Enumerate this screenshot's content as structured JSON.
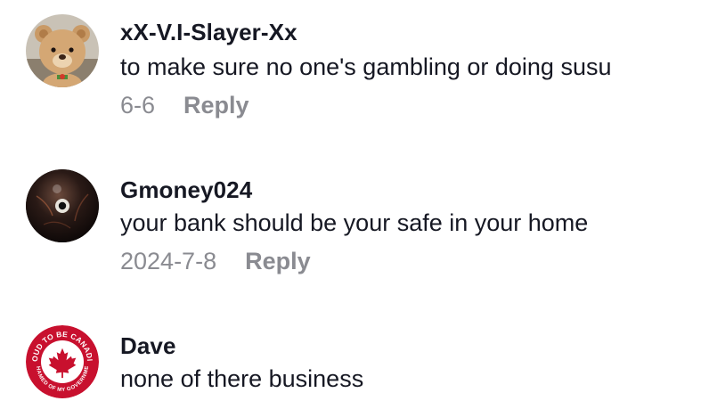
{
  "comments": [
    {
      "username": "xX-V.I-Slayer-Xx",
      "text": "to make sure no one's gambling or doing susu",
      "date": "6-6",
      "reply_label": "Reply",
      "avatar_icon": "teddy-bear-avatar"
    },
    {
      "username": "Gmoney024",
      "text": "your bank should be your safe in your home",
      "date": "2024-7-8",
      "reply_label": "Reply",
      "avatar_icon": "eight-ball-avatar"
    },
    {
      "username": "Dave",
      "text": "none of there business",
      "avatar_icon": "canadian-badge-avatar",
      "badge_top_text": "PROUD TO BE CANADIAN",
      "badge_bottom_text": "ASHAMED OF MY GOVERNMENT"
    }
  ],
  "colors": {
    "text": "#161823",
    "secondary": "#8a8b91",
    "badge_red": "#c8102e"
  }
}
